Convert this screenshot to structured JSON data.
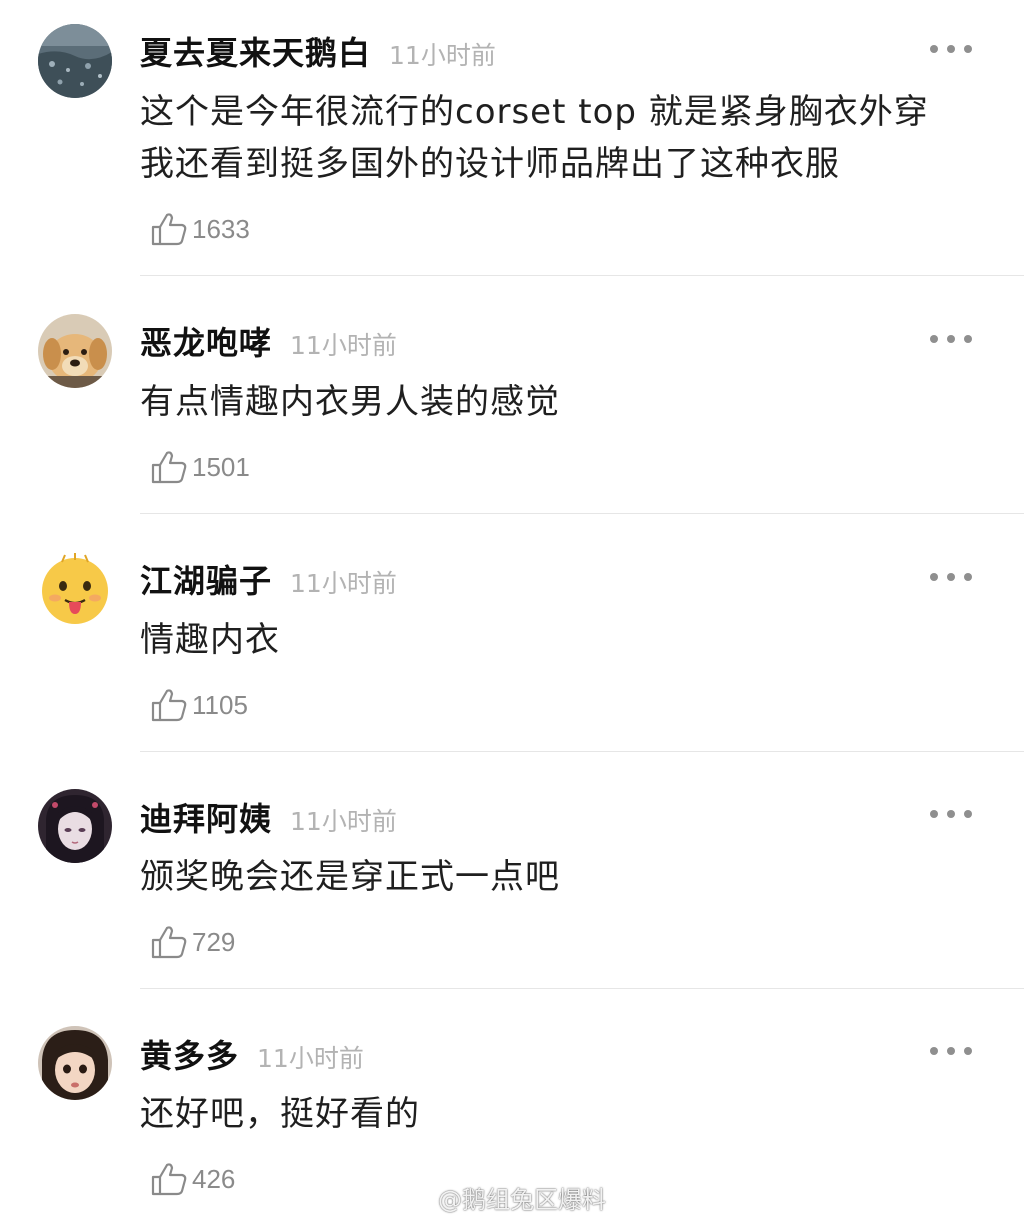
{
  "comments": [
    {
      "username": "夏去夏来天鹅白",
      "time": "11小时前",
      "text_lines": [
        "这个是今年很流行的corset top 就是紧身胸衣外穿",
        "我还看到挺多国外的设计师品牌出了这种衣服"
      ],
      "likes": "1633",
      "avatar": "landscape-avatar-icon"
    },
    {
      "username": "恶龙咆哮",
      "time": "11小时前",
      "text_lines": [
        "有点情趣内衣男人装的感觉"
      ],
      "likes": "1501",
      "avatar": "dog-avatar-icon"
    },
    {
      "username": "江湖骗子",
      "time": "11小时前",
      "text_lines": [
        "情趣内衣"
      ],
      "likes": "1105",
      "avatar": "emoji-tongue-avatar-icon"
    },
    {
      "username": "迪拜阿姨",
      "time": "11小时前",
      "text_lines": [
        "颁奖晚会还是穿正式一点吧"
      ],
      "likes": "729",
      "avatar": "anime-girl-avatar-icon"
    },
    {
      "username": "黄多多",
      "time": "11小时前",
      "text_lines": [
        "还好吧，挺好看的"
      ],
      "likes": "426",
      "avatar": "child-avatar-icon"
    }
  ],
  "watermark": {
    "text": "@鹅组兔区爆料",
    "icon": "weibo-logo-icon"
  },
  "colors": {
    "username": "#111111",
    "timestamp": "#b3b3b3",
    "like": "#8a8a8a",
    "divider": "#e6e6e6"
  }
}
